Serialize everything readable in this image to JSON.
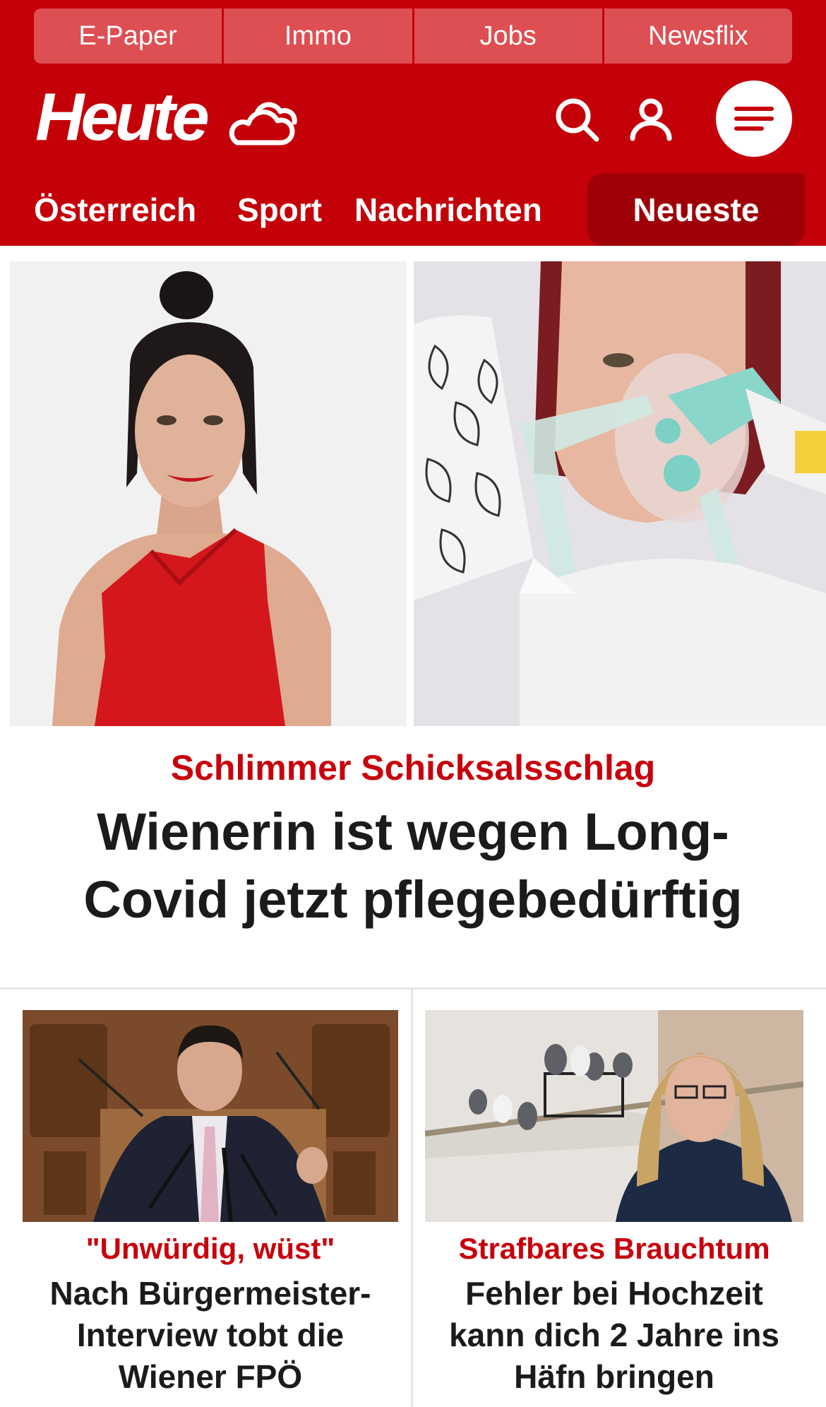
{
  "quick_links": [
    "E-Paper",
    "Immo",
    "Jobs",
    "Newsflix"
  ],
  "brand": {
    "name": "Heute",
    "accent": "#c40008",
    "weather_icon": "cloud-sun-icon"
  },
  "header_icons": {
    "search": "search-icon",
    "account": "user-icon",
    "menu": "menu-icon"
  },
  "nav": {
    "items": [
      "Österreich",
      "Sport",
      "Nachrichten"
    ],
    "active": "Neueste"
  },
  "hero": {
    "kicker": "Schlimmer Schicksalsschlag",
    "title": "Wienerin ist wegen Long-Covid jetzt pflegebedürftig"
  },
  "teasers": [
    {
      "kicker": "\"Unwürdig, wüst\"",
      "title": "Nach Bürgermeister-Interview tobt die Wiener FPÖ"
    },
    {
      "kicker": "Strafbares Brauchtum",
      "title": "Fehler bei Hochzeit kann dich 2 Jahre ins Häfn bringen"
    }
  ]
}
